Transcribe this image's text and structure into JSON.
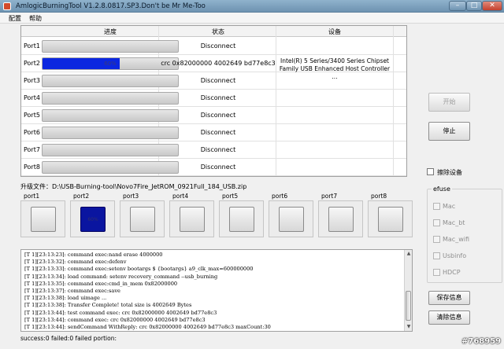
{
  "window": {
    "title": "AmlogicBurningTool  V1.2.8.0817.SP3.Don't be Mr Me-Too"
  },
  "menu": [
    "配置",
    "帮助"
  ],
  "grid": {
    "columns": [
      "进度",
      "状态",
      "设备"
    ],
    "rows": [
      {
        "port": "Port1",
        "progress": 0,
        "progress_text": "",
        "status": "Disconnect",
        "device": ""
      },
      {
        "port": "Port2",
        "progress": 0.57,
        "progress_text": "60%",
        "status": "crc 0x82000000 4002649 bd77e8c3",
        "device": "Intel(R) 5 Series/3400 Series Chipset Family USB Enhanced Host Controller ..."
      },
      {
        "port": "Port3",
        "progress": 0,
        "progress_text": "",
        "status": "Disconnect",
        "device": ""
      },
      {
        "port": "Port4",
        "progress": 0,
        "progress_text": "",
        "status": "Disconnect",
        "device": ""
      },
      {
        "port": "Port5",
        "progress": 0,
        "progress_text": "",
        "status": "Disconnect",
        "device": ""
      },
      {
        "port": "Port6",
        "progress": 0,
        "progress_text": "",
        "status": "Disconnect",
        "device": ""
      },
      {
        "port": "Port7",
        "progress": 0,
        "progress_text": "",
        "status": "Disconnect",
        "device": ""
      },
      {
        "port": "Port8",
        "progress": 0,
        "progress_text": "",
        "status": "Disconnect",
        "device": ""
      }
    ]
  },
  "buttons": {
    "start": "开始",
    "stop": "停止",
    "save_info": "保存信息",
    "clear_info": "清除信息"
  },
  "erase_device": {
    "label": "擦除设备",
    "checked": false
  },
  "efuse": {
    "title": "efuse",
    "items": [
      "Mac",
      "Mac_bt",
      "Mac_wifi",
      "Usbinfo",
      "HDCP"
    ]
  },
  "upgrade_file": "升级文件：D:\\USB-Burning-tool\\Novo7Fire_JetROM_0921Full_184_USB.zip",
  "ports": [
    {
      "label": "port1",
      "active": false,
      "text": ""
    },
    {
      "label": "port2",
      "active": true,
      "text": "60%"
    },
    {
      "label": "port3",
      "active": false,
      "text": ""
    },
    {
      "label": "port4",
      "active": false,
      "text": ""
    },
    {
      "label": "port5",
      "active": false,
      "text": ""
    },
    {
      "label": "port6",
      "active": false,
      "text": ""
    },
    {
      "label": "port7",
      "active": false,
      "text": ""
    },
    {
      "label": "port8",
      "active": false,
      "text": ""
    }
  ],
  "log": [
    "[T 1][23:13:23]: command exec:nand erase 4000000",
    "[T 1][23:13:32]: command exec:defenv",
    "[T 1][23:13:33]: command exec:setenv bootargs $ {bootargs} a9_clk_max=600000000",
    "[T 1][23:13:34]: load command: setenv recovery_command --usb_burning",
    "[T 1][23:13:35]: command exec:cmd_in_mem 0x82000000",
    "[T 1][23:13:37]: command exec:save",
    "[T 1][23:13:38]: load uimage ...",
    "[T 1][23:13:38]: Transfer Complete! total size is 4002649 Bytes",
    "[T 1][23:13:44]: test command exec: crc 0x82000000 4002649 bd77e8c3",
    "[T 1][23:13:44]: command exec: crc 0x82000000 4002649 bd77e8c3",
    "[T 1][23:13:44]: sendCommand WithReply: crc 0x82000000 4002649 bd77e8c3 maxCount:30"
  ],
  "status": "success:0 failed:0 failed portion:",
  "watermark": "#768959"
}
